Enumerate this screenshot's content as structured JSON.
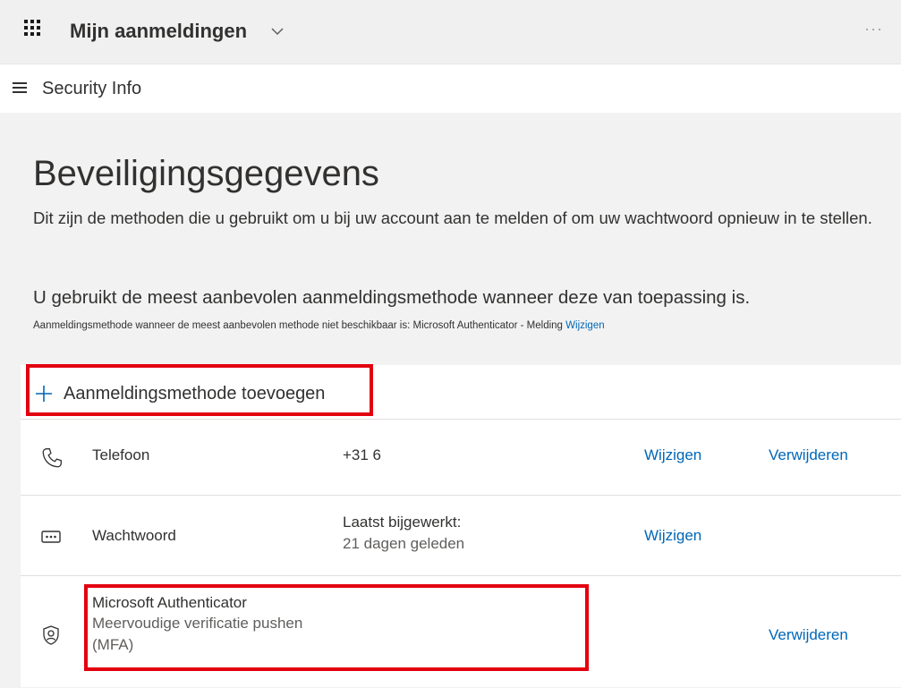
{
  "topbar": {
    "app_title": "Mijn aanmeldingen",
    "more_label": "···"
  },
  "subbar": {
    "title": "Security Info"
  },
  "page": {
    "title": "Beveiligingsgegevens",
    "description": "Dit zijn de methoden die u gebruikt om u bij uw account aan te melden of om uw wachtwoord opnieuw in te stellen.",
    "recommendation": "U gebruikt de meest aanbevolen aanmeldingsmethode wanneer deze van toepassing is.",
    "fallback_prefix": "Aanmeldingsmethode wanneer de meest aanbevolen methode niet beschikbaar is: Microsoft Authenticator - Melding ",
    "fallback_link": "Wijzigen"
  },
  "methods": {
    "add_label": "Aanmeldingsmethode toevoegen",
    "rows": [
      {
        "icon": "phone-icon",
        "name": "Telefoon",
        "detail": "+31 6",
        "change_label": "Wijzigen",
        "delete_label": "Verwijderen"
      },
      {
        "icon": "password-icon",
        "name": "Wachtwoord",
        "detail_line1": "Laatst bijgewerkt:",
        "detail_line2": "21 dagen geleden",
        "change_label": "Wijzigen"
      },
      {
        "icon": "authenticator-icon",
        "name": "Microsoft Authenticator",
        "sub_line1": "Meervoudige verificatie pushen",
        "sub_line2": "(MFA)",
        "delete_label": "Verwijderen"
      }
    ]
  },
  "colors": {
    "link": "#0067b8",
    "highlight": "#e3000f",
    "background": "#f2f2f2"
  }
}
